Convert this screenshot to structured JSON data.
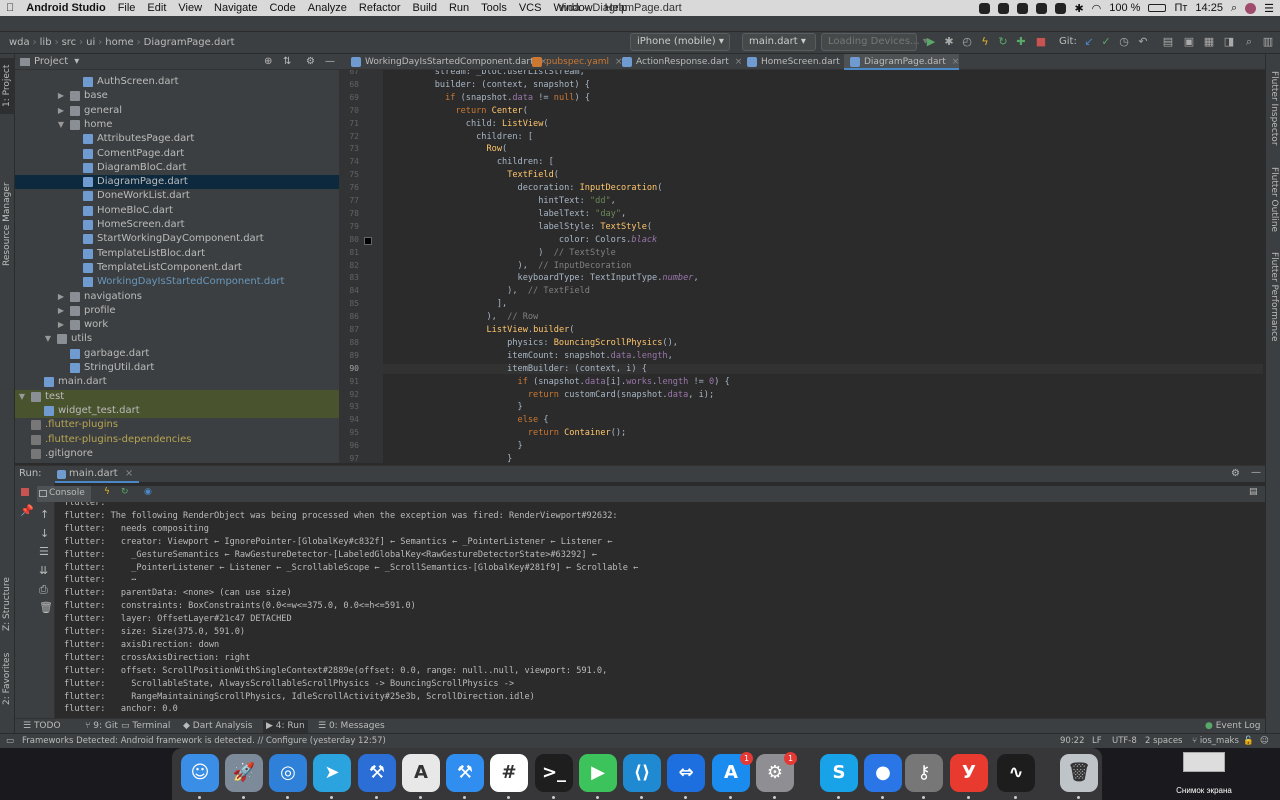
{
  "menubar": {
    "app_name": "Android Studio",
    "items": [
      "File",
      "Edit",
      "View",
      "Navigate",
      "Code",
      "Analyze",
      "Refactor",
      "Build",
      "Run",
      "Tools",
      "VCS",
      "Window",
      "Help"
    ],
    "window_title": "wda – DiagramPage.dart",
    "battery": "100 %",
    "day": "Пт",
    "time": "14:25"
  },
  "breadcrumb": [
    "wda",
    "lib",
    "src",
    "ui",
    "home",
    "DiagramPage.dart"
  ],
  "toolbar": {
    "device": "iPhone (mobile)",
    "run_config": "main.dart",
    "loading": "Loading Devices...",
    "git_label": "Git:"
  },
  "sidebar_left_tabs": [
    "1: Project",
    "Resource Manager",
    "Z: Structure",
    "2: Favorites"
  ],
  "sidebar_right_tabs": [
    "Flutter Inspector",
    "Flutter Outline",
    "Flutter Performance"
  ],
  "project": {
    "header": "Project",
    "tree": [
      {
        "label": "AuthScreen.dart",
        "indent": 4,
        "type": "dart"
      },
      {
        "label": "base",
        "indent": 3,
        "type": "folder",
        "arrow": "▶"
      },
      {
        "label": "general",
        "indent": 3,
        "type": "folder",
        "arrow": "▶"
      },
      {
        "label": "home",
        "indent": 3,
        "type": "folder",
        "arrow": "▼"
      },
      {
        "label": "AttributesPage.dart",
        "indent": 4,
        "type": "dart"
      },
      {
        "label": "ComentPage.dart",
        "indent": 4,
        "type": "dart"
      },
      {
        "label": "DiagramBloC.dart",
        "indent": 4,
        "type": "dart"
      },
      {
        "label": "DiagramPage.dart",
        "indent": 4,
        "type": "dart",
        "selected": true
      },
      {
        "label": "DoneWorkList.dart",
        "indent": 4,
        "type": "dart"
      },
      {
        "label": "HomeBloC.dart",
        "indent": 4,
        "type": "dart"
      },
      {
        "label": "HomeScreen.dart",
        "indent": 4,
        "type": "dart"
      },
      {
        "label": "StartWorkingDayComponent.dart",
        "indent": 4,
        "type": "dart"
      },
      {
        "label": "TemplateListBloc.dart",
        "indent": 4,
        "type": "dart"
      },
      {
        "label": "TemplateListComponent.dart",
        "indent": 4,
        "type": "dart"
      },
      {
        "label": "WorkingDayIsStartedComponent.dart",
        "indent": 4,
        "type": "dart",
        "color": "blue"
      },
      {
        "label": "navigations",
        "indent": 3,
        "type": "folder",
        "arrow": "▶"
      },
      {
        "label": "profile",
        "indent": 3,
        "type": "folder",
        "arrow": "▶"
      },
      {
        "label": "work",
        "indent": 3,
        "type": "folder",
        "arrow": "▶"
      },
      {
        "label": "utils",
        "indent": 2,
        "type": "folder",
        "arrow": "▼"
      },
      {
        "label": "garbage.dart",
        "indent": 3,
        "type": "dart"
      },
      {
        "label": "StringUtil.dart",
        "indent": 3,
        "type": "dart"
      },
      {
        "label": "main.dart",
        "indent": 1,
        "type": "dart"
      },
      {
        "label": "test",
        "indent": 0,
        "type": "folder",
        "arrow": "▼",
        "test": true
      },
      {
        "label": "widget_test.dart",
        "indent": 1,
        "type": "dart",
        "test": true
      },
      {
        "label": ".flutter-plugins",
        "indent": 0,
        "type": "gen",
        "color": "yellow"
      },
      {
        "label": ".flutter-plugins-dependencies",
        "indent": 0,
        "type": "gen",
        "color": "yellow"
      },
      {
        "label": ".gitignore",
        "indent": 0,
        "type": "gen"
      }
    ]
  },
  "editor_tabs": [
    {
      "label": "WorkingDayIsStartedComponent.dart"
    },
    {
      "label": "pubspec.yaml",
      "modified": true
    },
    {
      "label": "ActionResponse.dart"
    },
    {
      "label": "HomeScreen.dart"
    },
    {
      "label": "DiagramPage.dart",
      "active": true
    }
  ],
  "code": {
    "current_line": "90",
    "lines": [
      {
        "n": "67",
        "html": "          stream: _bloc.userListStream,"
      },
      {
        "n": "68",
        "html": "          builder: (context, snapshot) {"
      },
      {
        "n": "69",
        "html": "            <span class='kw'>if</span> (snapshot.<span class='pr'>data</span> != <span class='kw'>null</span>) {"
      },
      {
        "n": "70",
        "html": "              <span class='kw'>return</span> <span class='cls'>Center</span>("
      },
      {
        "n": "71",
        "html": "                child: <span class='cls'>ListView</span>("
      },
      {
        "n": "72",
        "html": "                  children: ["
      },
      {
        "n": "73",
        "html": "                    <span class='cls'>Row</span>("
      },
      {
        "n": "74",
        "html": "                      children: ["
      },
      {
        "n": "75",
        "html": "                        <span class='cls'>TextField</span>("
      },
      {
        "n": "76",
        "html": "                          decoration: <span class='cls'>InputDecoration</span>("
      },
      {
        "n": "77",
        "html": "                              hintText: <span class='str'>\"dd\"</span>,"
      },
      {
        "n": "78",
        "html": "                              labelText: <span class='str'>\"day\"</span>,"
      },
      {
        "n": "79",
        "html": "                              labelStyle: <span class='cls'>TextStyle</span>("
      },
      {
        "n": "80",
        "html": "                                  color: Colors.<span class='it'>black</span>"
      },
      {
        "n": "81",
        "html": "                              )  <span class='cm'>// TextStyle</span>"
      },
      {
        "n": "82",
        "html": "                          ),  <span class='cm'>// InputDecoration</span>"
      },
      {
        "n": "83",
        "html": "                          keyboardType: TextInputType.<span class='it'>number</span>,"
      },
      {
        "n": "84",
        "html": "                        ),  <span class='cm'>// TextField</span>"
      },
      {
        "n": "85",
        "html": "                      ],"
      },
      {
        "n": "86",
        "html": "                    ),  <span class='cm'>// Row</span>"
      },
      {
        "n": "87",
        "html": "                    <span class='cls'>ListView</span>.<span class='cls'>builder</span>("
      },
      {
        "n": "88",
        "html": "                        physics: <span class='cls'>BouncingScrollPhysics</span>(),"
      },
      {
        "n": "89",
        "html": "                        itemCount: snapshot.<span class='pr'>data</span>.<span class='pr'>length</span>,"
      },
      {
        "n": "90",
        "html": "                        itemBuilder: (context, i) {"
      },
      {
        "n": "91",
        "html": "                          <span class='kw'>if</span> (snapshot.<span class='pr'>data</span>[i].<span class='pr'>works</span>.<span class='pr'>length</span> != <span class='pr'>0</span>) {"
      },
      {
        "n": "92",
        "html": "                            <span class='kw'>return</span> customCard(snapshot.<span class='pr'>data</span>, i);"
      },
      {
        "n": "93",
        "html": "                          }"
      },
      {
        "n": "94",
        "html": "                          <span class='kw'>else</span> {"
      },
      {
        "n": "95",
        "html": "                            <span class='kw'>return</span> <span class='cls'>Container</span>();"
      },
      {
        "n": "96",
        "html": "                          }"
      },
      {
        "n": "97",
        "html": "                        }"
      }
    ]
  },
  "run_panel": {
    "title": "Run:",
    "config_tab": "main.dart",
    "console_tab": "Console",
    "lines": [
      "flutter:",
      "flutter: The following RenderObject was being processed when the exception was fired: RenderViewport#92632:",
      "flutter:   needs compositing",
      "flutter:   creator: Viewport ← IgnorePointer-[GlobalKey#c832f] ← Semantics ← _PointerListener ← Listener ←",
      "flutter:     _GestureSemantics ← RawGestureDetector-[LabeledGlobalKey<RawGestureDetectorState>#63292] ←",
      "flutter:     _PointerListener ← Listener ← _ScrollableScope ← _ScrollSemantics-[GlobalKey#281f9] ← Scrollable ←",
      "flutter:     ⋯",
      "flutter:   parentData: <none> (can use size)",
      "flutter:   constraints: BoxConstraints(0.0<=w<=375.0, 0.0<=h<=591.0)",
      "flutter:   layer: OffsetLayer#21c47 DETACHED",
      "flutter:   size: Size(375.0, 591.0)",
      "flutter:   axisDirection: down",
      "flutter:   crossAxisDirection: right",
      "flutter:   offset: ScrollPositionWithSingleContext#2889e(offset: 0.0, range: null..null, viewport: 591.0,",
      "flutter:     ScrollableState, AlwaysScrollableScrollPhysics -> BouncingScrollPhysics ->",
      "flutter:     RangeMaintainingScrollPhysics, IdleScrollActivity#25e3b, ScrollDirection.idle)",
      "flutter:   anchor: 0.0"
    ]
  },
  "bottom_tabs": [
    "TODO",
    "9: Git",
    "Terminal",
    "Dart Analysis",
    "4: Run",
    "0: Messages"
  ],
  "event_log": "Event Log",
  "status": {
    "message": "Frameworks Detected: Android framework is detected. // Configure (yesterday 12:57)",
    "position": "90:22",
    "line_sep": "LF",
    "encoding": "UTF-8",
    "indent": "2 spaces",
    "branch": "ios_maks"
  },
  "dock": {
    "apps": [
      {
        "name": "Finder",
        "glyph": "☺",
        "color": "#3a8ee6"
      },
      {
        "name": "Launchpad",
        "glyph": "🚀",
        "color": "#7d8a99"
      },
      {
        "name": "Safari",
        "glyph": "◎",
        "color": "#2f80d8"
      },
      {
        "name": "Telegram",
        "glyph": "➤",
        "color": "#2aa3df"
      },
      {
        "name": "Xcode",
        "glyph": "⚒",
        "color": "#2b6fd6"
      },
      {
        "name": "Android Studio",
        "glyph": "A",
        "color": "#e8e8e8"
      },
      {
        "name": "Instruments",
        "glyph": "⚒",
        "color": "#2f8ef0"
      },
      {
        "name": "Slack",
        "glyph": "#",
        "color": "#ffffff"
      },
      {
        "name": "Terminal",
        "glyph": ">_",
        "color": "#1e1e1e"
      },
      {
        "name": "FaceTime",
        "glyph": "▶",
        "color": "#3cc35b"
      },
      {
        "name": "VS Code",
        "glyph": "⟨⟩",
        "color": "#1f8ad2"
      },
      {
        "name": "TeamViewer",
        "glyph": "⇔",
        "color": "#1d6fe0"
      },
      {
        "name": "App Store",
        "glyph": "A",
        "color": "#1a8cf0"
      },
      {
        "name": "System Preferences",
        "glyph": "⚙",
        "color": "#8e8e93"
      },
      {
        "name": "Skype",
        "glyph": "S",
        "color": "#18a3e8"
      },
      {
        "name": "Maps Pin",
        "glyph": "●",
        "color": "#2a76e6"
      },
      {
        "name": "Keychain",
        "glyph": "⚷",
        "color": "#777"
      },
      {
        "name": "Yandex",
        "glyph": "У",
        "color": "#e83a2e"
      },
      {
        "name": "Activity Monitor",
        "glyph": "∿",
        "color": "#1d1d1d"
      },
      {
        "name": "Trash",
        "glyph": "🗑",
        "color": "#bfc4c9"
      }
    ],
    "badges": [
      {
        "app": "App Store",
        "count": "1"
      },
      {
        "app": "System Preferences",
        "count": "1"
      }
    ],
    "screenshot_label": "Снимок экрана"
  }
}
